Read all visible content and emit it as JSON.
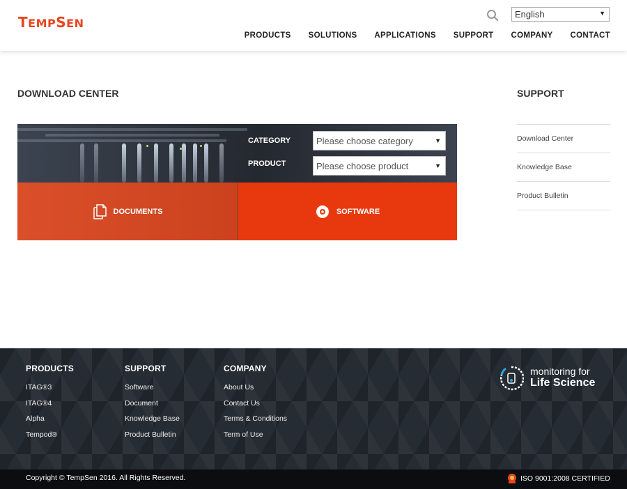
{
  "header": {
    "logo": {
      "initial": "T",
      "mid": "EMP",
      "initial2": "S",
      "rest": "EN"
    },
    "language": "English",
    "nav": [
      "PRODUCTS",
      "SOLUTIONS",
      "APPLICATIONS",
      "SUPPORT",
      "COMPANY",
      "CONTACT"
    ]
  },
  "main": {
    "title": "DOWNLOAD CENTER",
    "filters": {
      "category_label": "CATEGORY",
      "category_placeholder": "Please choose category",
      "product_label": "PRODUCT",
      "product_placeholder": "Please choose product"
    },
    "tabs": {
      "documents": "DOCUMENTS",
      "software": "SOFTWARE"
    }
  },
  "sidebar": {
    "title": "SUPPORT",
    "items": [
      "Download Center",
      "Knowledge Base",
      "Product Bulletin"
    ]
  },
  "footer": {
    "columns": [
      {
        "title": "PRODUCTS",
        "links": [
          "ITAG®3",
          "ITAG®4",
          "Alpha",
          "Tempod®"
        ]
      },
      {
        "title": "SUPPORT",
        "links": [
          "Software",
          "Document",
          "Knowledge Base",
          "Product Bulletin"
        ]
      },
      {
        "title": "COMPANY",
        "links": [
          "About Us",
          "Contact Us",
          "Terms & Conditions",
          "Term of Use"
        ]
      }
    ],
    "brand_line1": "monitoring for",
    "brand_line2": "Life Science",
    "copyright": "Copyright © TempSen 2016. All Rights Reserved.",
    "iso": "ISO 9001:2008 CERTIFIED"
  },
  "colors": {
    "accent": "#e8390e",
    "footer_bg": "#262c33",
    "bottom_bar": "#0b0d10"
  }
}
